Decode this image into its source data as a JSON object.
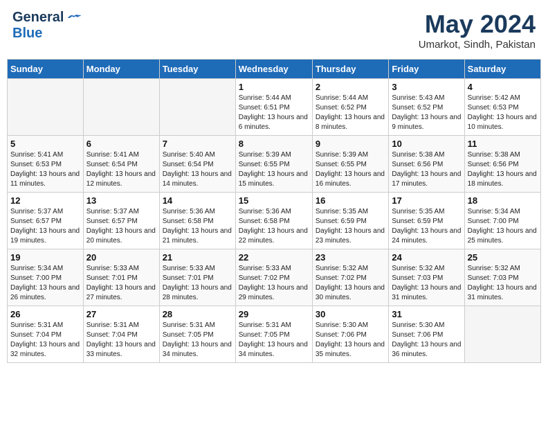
{
  "header": {
    "logo_general": "General",
    "logo_blue": "Blue",
    "month": "May 2024",
    "location": "Umarkot, Sindh, Pakistan"
  },
  "weekdays": [
    "Sunday",
    "Monday",
    "Tuesday",
    "Wednesday",
    "Thursday",
    "Friday",
    "Saturday"
  ],
  "weeks": [
    [
      {
        "num": "",
        "info": ""
      },
      {
        "num": "",
        "info": ""
      },
      {
        "num": "",
        "info": ""
      },
      {
        "num": "1",
        "info": "Sunrise: 5:44 AM\nSunset: 6:51 PM\nDaylight: 13 hours and 6 minutes."
      },
      {
        "num": "2",
        "info": "Sunrise: 5:44 AM\nSunset: 6:52 PM\nDaylight: 13 hours and 8 minutes."
      },
      {
        "num": "3",
        "info": "Sunrise: 5:43 AM\nSunset: 6:52 PM\nDaylight: 13 hours and 9 minutes."
      },
      {
        "num": "4",
        "info": "Sunrise: 5:42 AM\nSunset: 6:53 PM\nDaylight: 13 hours and 10 minutes."
      }
    ],
    [
      {
        "num": "5",
        "info": "Sunrise: 5:41 AM\nSunset: 6:53 PM\nDaylight: 13 hours and 11 minutes."
      },
      {
        "num": "6",
        "info": "Sunrise: 5:41 AM\nSunset: 6:54 PM\nDaylight: 13 hours and 12 minutes."
      },
      {
        "num": "7",
        "info": "Sunrise: 5:40 AM\nSunset: 6:54 PM\nDaylight: 13 hours and 14 minutes."
      },
      {
        "num": "8",
        "info": "Sunrise: 5:39 AM\nSunset: 6:55 PM\nDaylight: 13 hours and 15 minutes."
      },
      {
        "num": "9",
        "info": "Sunrise: 5:39 AM\nSunset: 6:55 PM\nDaylight: 13 hours and 16 minutes."
      },
      {
        "num": "10",
        "info": "Sunrise: 5:38 AM\nSunset: 6:56 PM\nDaylight: 13 hours and 17 minutes."
      },
      {
        "num": "11",
        "info": "Sunrise: 5:38 AM\nSunset: 6:56 PM\nDaylight: 13 hours and 18 minutes."
      }
    ],
    [
      {
        "num": "12",
        "info": "Sunrise: 5:37 AM\nSunset: 6:57 PM\nDaylight: 13 hours and 19 minutes."
      },
      {
        "num": "13",
        "info": "Sunrise: 5:37 AM\nSunset: 6:57 PM\nDaylight: 13 hours and 20 minutes."
      },
      {
        "num": "14",
        "info": "Sunrise: 5:36 AM\nSunset: 6:58 PM\nDaylight: 13 hours and 21 minutes."
      },
      {
        "num": "15",
        "info": "Sunrise: 5:36 AM\nSunset: 6:58 PM\nDaylight: 13 hours and 22 minutes."
      },
      {
        "num": "16",
        "info": "Sunrise: 5:35 AM\nSunset: 6:59 PM\nDaylight: 13 hours and 23 minutes."
      },
      {
        "num": "17",
        "info": "Sunrise: 5:35 AM\nSunset: 6:59 PM\nDaylight: 13 hours and 24 minutes."
      },
      {
        "num": "18",
        "info": "Sunrise: 5:34 AM\nSunset: 7:00 PM\nDaylight: 13 hours and 25 minutes."
      }
    ],
    [
      {
        "num": "19",
        "info": "Sunrise: 5:34 AM\nSunset: 7:00 PM\nDaylight: 13 hours and 26 minutes."
      },
      {
        "num": "20",
        "info": "Sunrise: 5:33 AM\nSunset: 7:01 PM\nDaylight: 13 hours and 27 minutes."
      },
      {
        "num": "21",
        "info": "Sunrise: 5:33 AM\nSunset: 7:01 PM\nDaylight: 13 hours and 28 minutes."
      },
      {
        "num": "22",
        "info": "Sunrise: 5:33 AM\nSunset: 7:02 PM\nDaylight: 13 hours and 29 minutes."
      },
      {
        "num": "23",
        "info": "Sunrise: 5:32 AM\nSunset: 7:02 PM\nDaylight: 13 hours and 30 minutes."
      },
      {
        "num": "24",
        "info": "Sunrise: 5:32 AM\nSunset: 7:03 PM\nDaylight: 13 hours and 31 minutes."
      },
      {
        "num": "25",
        "info": "Sunrise: 5:32 AM\nSunset: 7:03 PM\nDaylight: 13 hours and 31 minutes."
      }
    ],
    [
      {
        "num": "26",
        "info": "Sunrise: 5:31 AM\nSunset: 7:04 PM\nDaylight: 13 hours and 32 minutes."
      },
      {
        "num": "27",
        "info": "Sunrise: 5:31 AM\nSunset: 7:04 PM\nDaylight: 13 hours and 33 minutes."
      },
      {
        "num": "28",
        "info": "Sunrise: 5:31 AM\nSunset: 7:05 PM\nDaylight: 13 hours and 34 minutes."
      },
      {
        "num": "29",
        "info": "Sunrise: 5:31 AM\nSunset: 7:05 PM\nDaylight: 13 hours and 34 minutes."
      },
      {
        "num": "30",
        "info": "Sunrise: 5:30 AM\nSunset: 7:06 PM\nDaylight: 13 hours and 35 minutes."
      },
      {
        "num": "31",
        "info": "Sunrise: 5:30 AM\nSunset: 7:06 PM\nDaylight: 13 hours and 36 minutes."
      },
      {
        "num": "",
        "info": ""
      }
    ]
  ]
}
